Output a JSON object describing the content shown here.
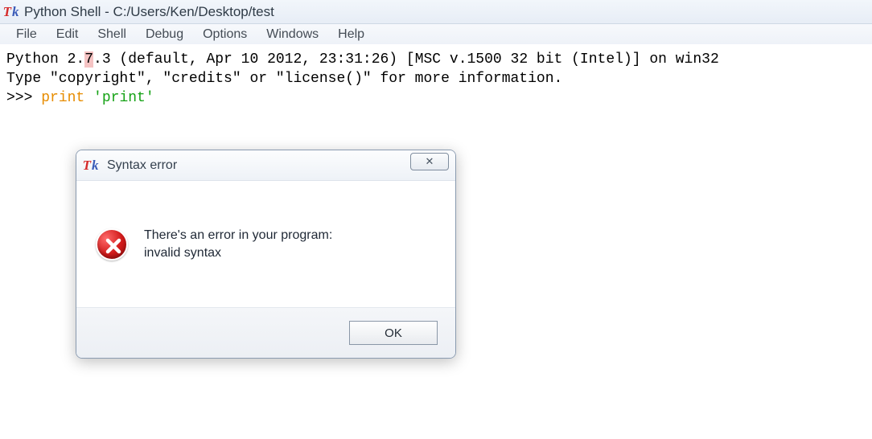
{
  "window": {
    "title": "Python Shell - C:/Users/Ken/Desktop/test"
  },
  "menubar": {
    "items": [
      "File",
      "Edit",
      "Shell",
      "Debug",
      "Options",
      "Windows",
      "Help"
    ]
  },
  "shell": {
    "line1_a": "Python 2.",
    "line1_hl": "7",
    "line1_b": ".3 (default, Apr 10 2012, 23:31:26) [MSC v.1500 32 bit (Intel)] on win32",
    "line2": "Type \"copyright\", \"credits\" or \"license()\" for more information.",
    "prompt": ">>> ",
    "kw": "print",
    "space": " ",
    "str": "'print'"
  },
  "dialog": {
    "title": "Syntax error",
    "close_glyph": "✕",
    "message_line1": "There's an error in your program:",
    "message_line2": "invalid syntax",
    "ok_label": "OK"
  }
}
